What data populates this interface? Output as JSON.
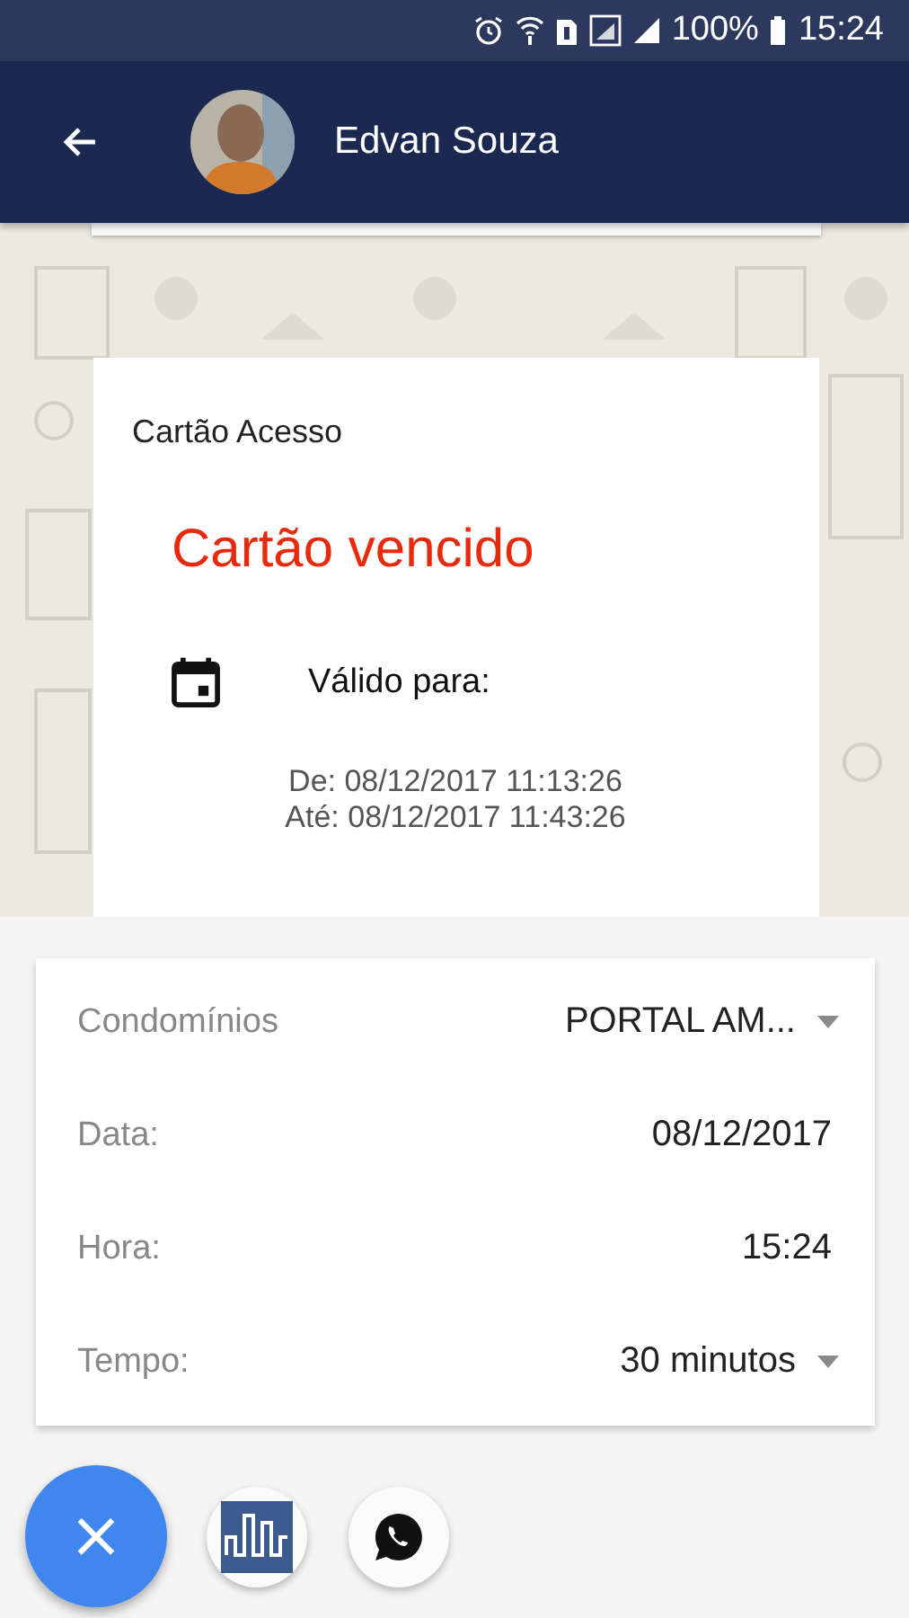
{
  "status_bar": {
    "battery": "100%",
    "time": "15:24"
  },
  "app_bar": {
    "title": "Edvan Souza"
  },
  "card": {
    "title": "Cartão Acesso",
    "status": "Cartão vencido",
    "valid_label": "Válido para:",
    "from": "De: 08/12/2017 11:13:26",
    "until": "Até: 08/12/2017 11:43:26"
  },
  "form": {
    "rows": [
      {
        "label": "Condomínios",
        "value": "PORTAL AM...",
        "kind": "dropdown"
      },
      {
        "label": "Data:",
        "value": "08/12/2017",
        "kind": "value"
      },
      {
        "label": "Hora:",
        "value": "15:24",
        "kind": "value"
      },
      {
        "label": "Tempo:",
        "value": "30 minutos",
        "kind": "dropdown"
      }
    ]
  },
  "fab": {
    "label": "×"
  }
}
